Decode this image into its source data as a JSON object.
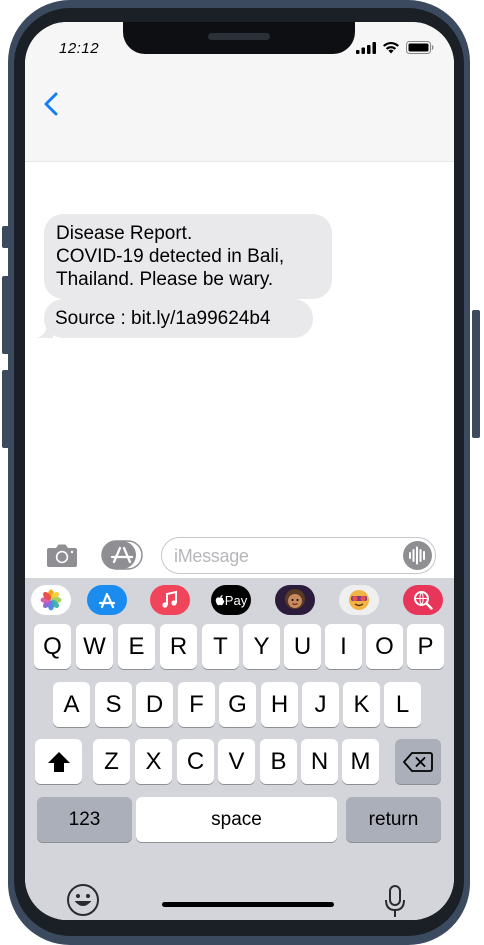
{
  "status": {
    "time": "12:12"
  },
  "messages": [
    {
      "lines": [
        "Disease Report.",
        "COVID-19 detected in Bali,",
        "Thailand. Please be wary."
      ]
    },
    {
      "text": "Source : bit.ly/1a99624b4"
    }
  ],
  "compose": {
    "placeholder": "iMessage"
  },
  "app_strip": [
    "photos-icon",
    "app-store-icon",
    "music-icon",
    "apple-pay-icon",
    "memoji-icon",
    "animoji-icon",
    "web-search-icon"
  ],
  "apple_pay_label": "Pay",
  "keyboard": {
    "row1": [
      "Q",
      "W",
      "E",
      "R",
      "T",
      "Y",
      "U",
      "I",
      "O",
      "P"
    ],
    "row2": [
      "A",
      "S",
      "D",
      "F",
      "G",
      "H",
      "J",
      "K",
      "L"
    ],
    "row3": [
      "Z",
      "X",
      "C",
      "V",
      "B",
      "N",
      "M"
    ],
    "numbers_label": "123",
    "space_label": "space",
    "return_label": "return"
  },
  "colors": {
    "accent": "#147efb",
    "bubble": "#e9e9eb",
    "keyboard": "#d3d5db"
  }
}
